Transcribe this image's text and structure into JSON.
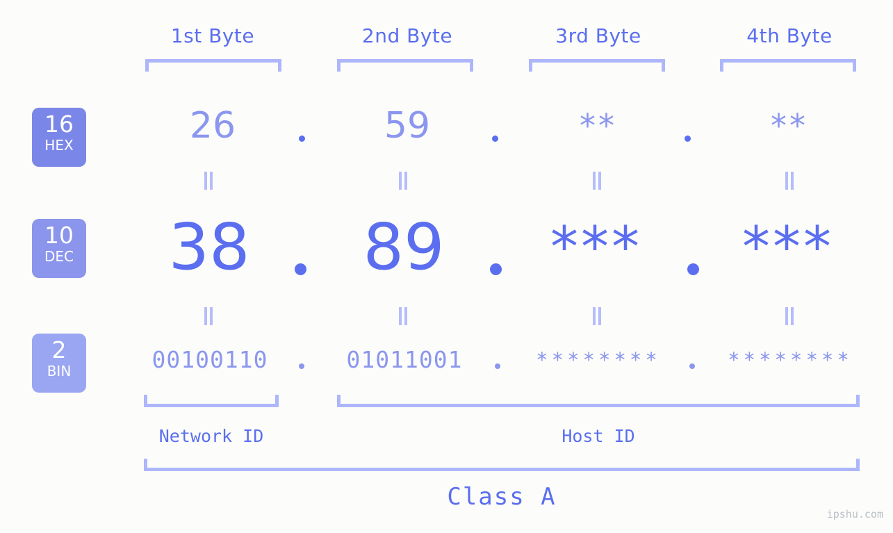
{
  "background_color": "#fcfdfa",
  "accent_color": "#5b6ef0",
  "accent_light_color": "#8b96ef",
  "bracket_color": "#aeb6fb",
  "headers": [
    {
      "label": "1st Byte"
    },
    {
      "label": "2nd Byte"
    },
    {
      "label": "3rd Byte"
    },
    {
      "label": "4th Byte"
    }
  ],
  "rows": [
    {
      "radix": "16",
      "radix_name": "HEX",
      "badge_color": "#7b87e8",
      "values": [
        "26",
        "59",
        "**",
        "**"
      ]
    },
    {
      "radix": "10",
      "radix_name": "DEC",
      "badge_color": "#8b95ec",
      "values": [
        "38",
        "89",
        "***",
        "***"
      ]
    },
    {
      "radix": "2",
      "radix_name": "BIN",
      "badge_color": "#9aa6f2",
      "values": [
        "00100110",
        "01011001",
        "********",
        "********"
      ]
    }
  ],
  "separator": ".",
  "sections": [
    {
      "label": "Network ID"
    },
    {
      "label": "Host ID"
    }
  ],
  "class": {
    "label": "Class A"
  },
  "watermark": {
    "label": "ipshu.com"
  }
}
